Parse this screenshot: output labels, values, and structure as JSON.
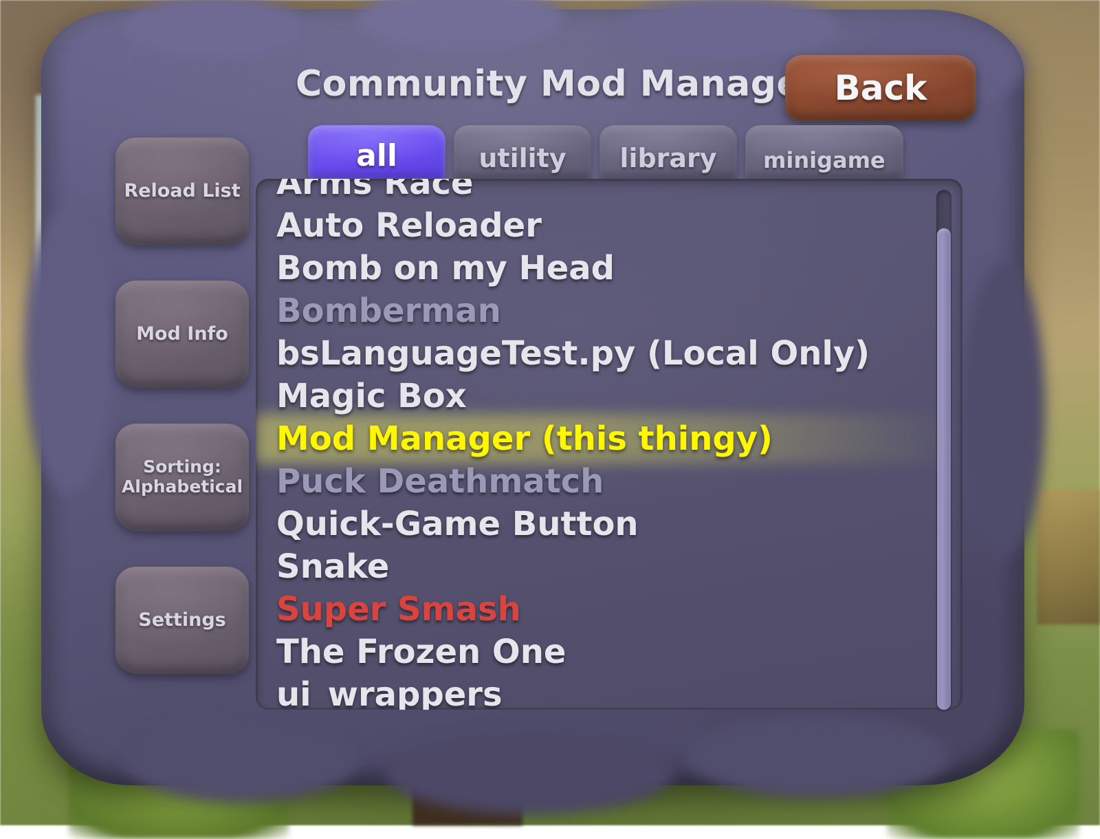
{
  "window": {
    "title": "Community Mod Manager"
  },
  "header": {
    "title": "Community Mod Manager",
    "back_label": "Back",
    "back_color": "#8b4930"
  },
  "tabs": {
    "selected": "all",
    "items": [
      {
        "id": "all",
        "label": "all",
        "selected": true
      },
      {
        "id": "utility",
        "label": "utility",
        "selected": false
      },
      {
        "id": "library",
        "label": "library",
        "selected": false
      },
      {
        "id": "minigame",
        "label": "minigame",
        "selected": false
      }
    ],
    "selected_color": "#6a4ef0"
  },
  "sidebar": {
    "items": [
      {
        "id": "reload-list",
        "label": "Reload List",
        "lines": [
          "Reload List"
        ]
      },
      {
        "id": "mod-info",
        "label": "Mod Info",
        "lines": [
          "Mod Info"
        ]
      },
      {
        "id": "sorting",
        "label": "Sorting: Alphabetical",
        "lines": [
          "Sorting:",
          "Alphabetical"
        ]
      },
      {
        "id": "settings",
        "label": "Settings",
        "lines": [
          "Settings"
        ]
      }
    ]
  },
  "mod_list": {
    "scroll_clipped_top": true,
    "highlight_row_index": 6,
    "colors": {
      "enabled": "#e7e5ec",
      "disabled": "#9b98b8",
      "error": "#d9453e",
      "current": "#fff700",
      "highlight_band": "#d8d860"
    },
    "rows": [
      {
        "name": "Arms Race",
        "state": "enabled",
        "clipped": true
      },
      {
        "name": "Auto Reloader",
        "state": "enabled"
      },
      {
        "name": "Bomb on my Head",
        "state": "enabled"
      },
      {
        "name": "Bomberman",
        "state": "disabled"
      },
      {
        "name": "bsLanguageTest.py (Local Only)",
        "state": "enabled"
      },
      {
        "name": "Magic Box",
        "state": "enabled"
      },
      {
        "name": "Mod Manager (this thingy)",
        "state": "current"
      },
      {
        "name": "Puck Deathmatch",
        "state": "disabled"
      },
      {
        "name": "Quick-Game Button",
        "state": "enabled"
      },
      {
        "name": "Snake",
        "state": "enabled"
      },
      {
        "name": "Super Smash",
        "state": "error"
      },
      {
        "name": "The Frozen One",
        "state": "enabled"
      },
      {
        "name": "ui_wrappers",
        "state": "enabled"
      }
    ]
  },
  "scrollbar": {
    "orientation": "vertical",
    "thumb_position": "near-top"
  }
}
